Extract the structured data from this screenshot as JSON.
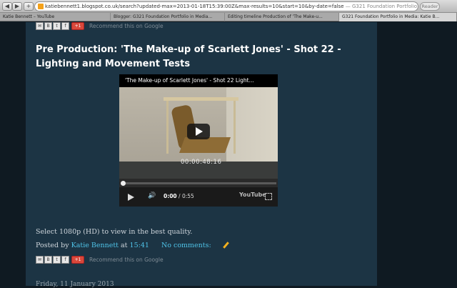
{
  "browser": {
    "url": "katiebennett1.blogspot.co.uk/search?updated-max=2013-01-18T15:39:00Z&max-results=10&start=10&by-date=false",
    "page_title": "G321 Foundation Portfolio in Media: Katie Bennett",
    "reader_label": "Reader",
    "tabs": [
      {
        "label": "Katie Bennett – YouTube"
      },
      {
        "label": "Blogger: G321 Foundation Portfolio in Media..."
      },
      {
        "label": "Editing timeline Production of 'The Make-u..."
      },
      {
        "label": "G321 Foundation Portfolio in Media: Katie B..."
      }
    ]
  },
  "share": {
    "recommend_text": "Recommend this on Google",
    "plusone_label": "+1"
  },
  "post": {
    "title": "Pre Production: 'The Make-up of Scarlett Jones' - Shot 22 - Lighting and Movement Tests",
    "video": {
      "title": "'The Make-up of Scarlett Jones' - Shot 22 Light...",
      "timecode": "00:00:48:16",
      "current_time": "0:00",
      "duration": "/ 0:55",
      "youtube_label": "YouTube"
    },
    "body": "Select 1080p (HD) to view in the best quality.",
    "posted_by_prefix": "Posted by",
    "author": "Katie Bennett",
    "at": "at",
    "time": "15:41",
    "comments": "No comments:"
  },
  "next_post_date": "Friday, 11 January 2013"
}
